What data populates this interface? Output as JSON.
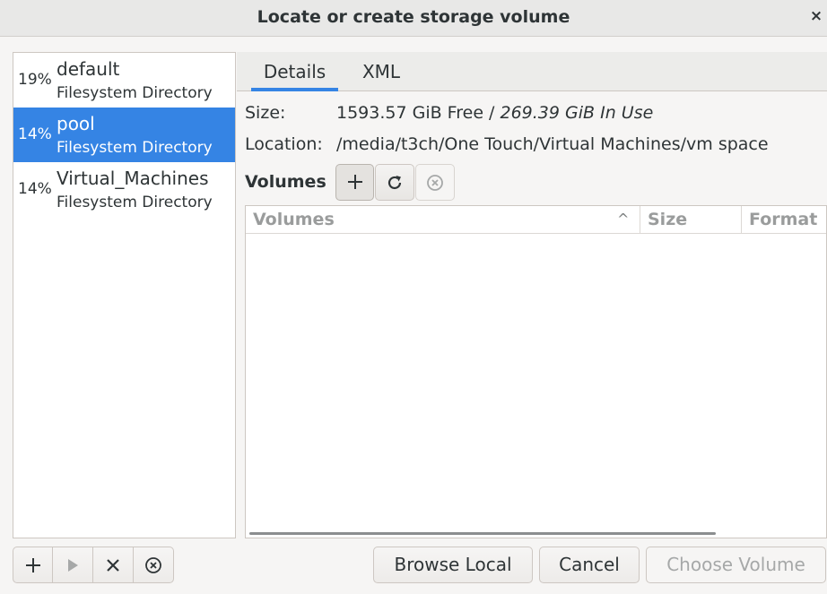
{
  "window": {
    "title": "Locate or create storage volume",
    "close_glyph": "×"
  },
  "pools": [
    {
      "percent": "19%",
      "name": "default",
      "type": "Filesystem Directory",
      "selected": false
    },
    {
      "percent": "14%",
      "name": "pool",
      "type": "Filesystem Directory",
      "selected": true
    },
    {
      "percent": "14%",
      "name": "Virtual_Machines",
      "type": "Filesystem Directory",
      "selected": false
    }
  ],
  "tabs": [
    {
      "label": "Details",
      "active": true
    },
    {
      "label": "XML",
      "active": false
    }
  ],
  "details": {
    "size_label": "Size:",
    "size_free": "1593.57 GiB Free / ",
    "size_in_use": "269.39 GiB In Use",
    "location_label": "Location:",
    "location_value": "/media/t3ch/One Touch/Virtual Machines/vm space"
  },
  "volumes": {
    "label": "Volumes",
    "add_icon": "plus-icon",
    "refresh_icon": "refresh-icon",
    "delete_icon": "delete-circle-icon",
    "columns": [
      "Volumes",
      "Size",
      "Format"
    ],
    "sort_indicator": "^",
    "rows": []
  },
  "pool_toolbar": {
    "add_icon": "plus-icon",
    "start_icon": "play-icon",
    "stop_icon": "stop-x-icon",
    "delete_icon": "delete-circle-icon"
  },
  "actions": {
    "browse_local": "Browse Local",
    "cancel": "Cancel",
    "choose_volume": "Choose Volume"
  },
  "colors": {
    "accent": "#3584e4",
    "background": "#f6f5f4",
    "disabled_text": "#a6a8a8"
  }
}
